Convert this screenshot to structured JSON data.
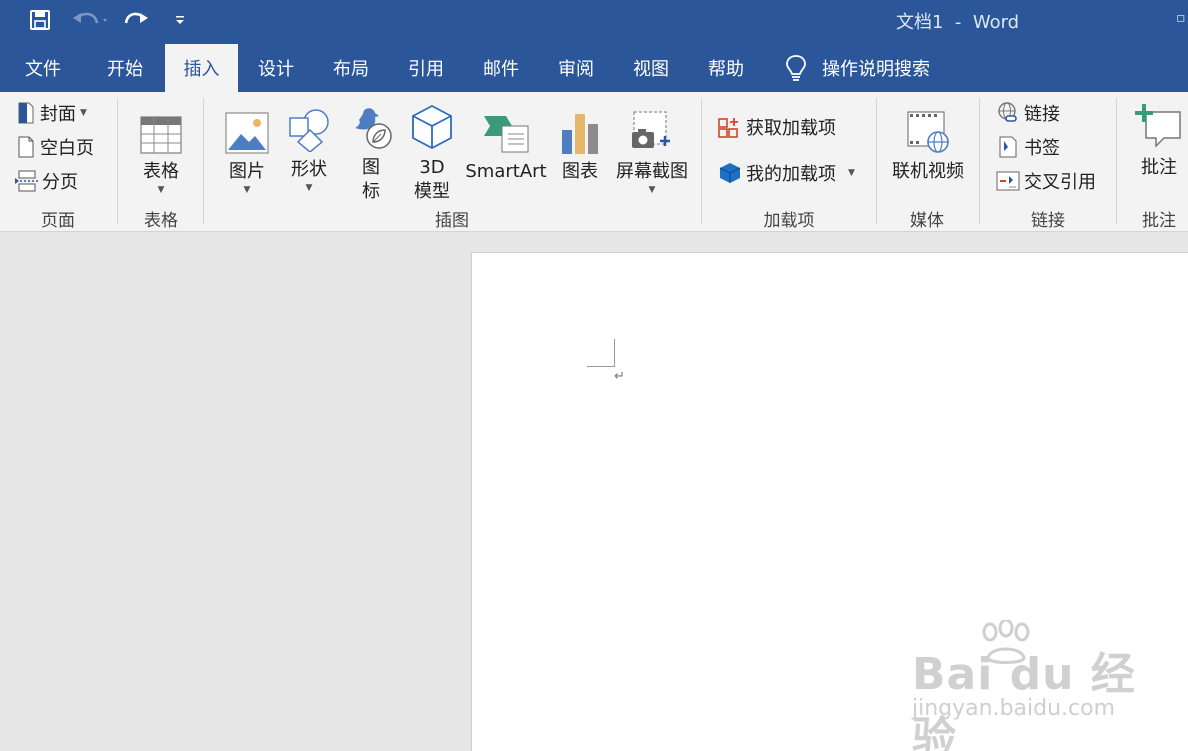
{
  "titlebar": {
    "title": "文档1  -  Word",
    "qat": [
      "save-icon",
      "undo-icon",
      "redo-icon",
      "customize-qat-icon"
    ]
  },
  "tabs": [
    "文件",
    "开始",
    "插入",
    "设计",
    "布局",
    "引用",
    "邮件",
    "审阅",
    "视图",
    "帮助"
  ],
  "active_tab": "插入",
  "tell_me": "操作说明搜索",
  "ribbon": {
    "pages": {
      "cover": "封面",
      "blank": "空白页",
      "break": "分页",
      "label": "页面"
    },
    "tables": {
      "table": "表格",
      "label": "表格"
    },
    "illustrations": {
      "picture": "图片",
      "shapes": "形状",
      "icons_1": "图",
      "icons_2": "标",
      "model_1": "3D",
      "model_2": "模型",
      "smartart": "SmartArt",
      "chart": "图表",
      "screenshot": "屏幕截图",
      "label": "插图"
    },
    "addins": {
      "get": "获取加载项",
      "my": "我的加载项",
      "label": "加载项"
    },
    "media": {
      "video": "联机视频",
      "label": "媒体"
    },
    "links": {
      "link": "链接",
      "bookmark": "书签",
      "crossref": "交叉引用",
      "label": "链接"
    },
    "comments": {
      "comment": "批注",
      "label": "批注"
    }
  },
  "document": {
    "paragraph_mark": "↵"
  },
  "watermark": {
    "main": "Bai du 经验",
    "sub": "jingyan.baidu.com"
  },
  "colors": {
    "brand": "#2b579a",
    "ribbon": "#f3f3f3",
    "canvas": "#e6e6e6",
    "accent_red": "#d24726"
  }
}
